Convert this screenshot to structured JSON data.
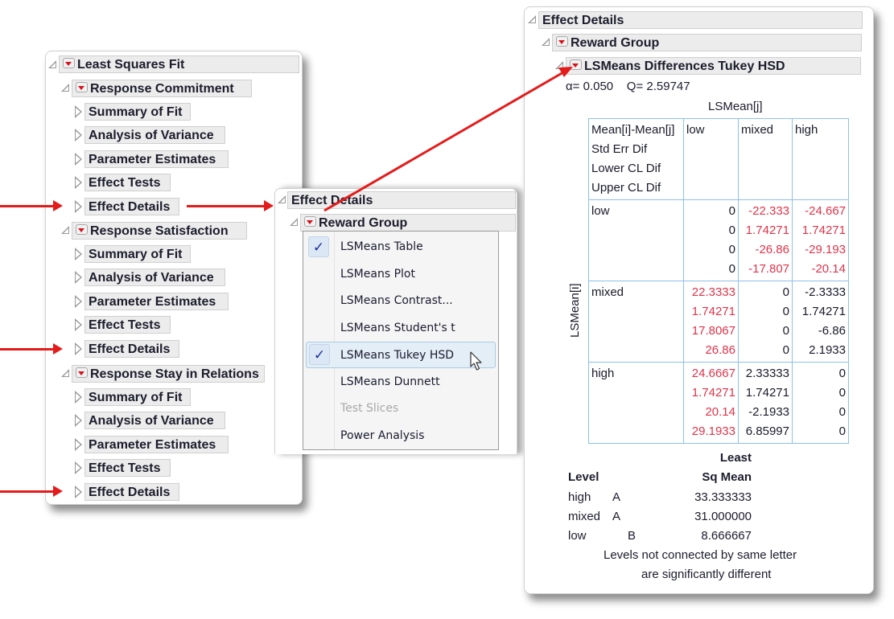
{
  "left_panel": {
    "root": {
      "label": "Least Squares Fit"
    },
    "responses": [
      {
        "label": "Response Commitment",
        "items": [
          "Summary of Fit",
          "Analysis of Variance",
          "Parameter Estimates",
          "Effect Tests",
          "Effect Details"
        ]
      },
      {
        "label": "Response Satisfaction",
        "items": [
          "Summary of Fit",
          "Analysis of Variance",
          "Parameter Estimates",
          "Effect Tests",
          "Effect Details"
        ]
      },
      {
        "label": "Response Stay in Relations",
        "items": [
          "Summary of Fit",
          "Analysis of Variance",
          "Parameter Estimates",
          "Effect Tests",
          "Effect Details"
        ]
      }
    ]
  },
  "middle_panel": {
    "title": "Effect Details",
    "group": "Reward Group",
    "menu": [
      {
        "label": "LSMeans Table",
        "checked": true,
        "enabled": true,
        "hover": false
      },
      {
        "label": "LSMeans Plot",
        "checked": false,
        "enabled": true,
        "hover": false
      },
      {
        "label": "LSMeans Contrast...",
        "checked": false,
        "enabled": true,
        "hover": false
      },
      {
        "label": "LSMeans Student's t",
        "checked": false,
        "enabled": true,
        "hover": false
      },
      {
        "label": "LSMeans Tukey HSD",
        "checked": true,
        "enabled": true,
        "hover": true
      },
      {
        "label": "LSMeans Dunnett",
        "checked": false,
        "enabled": true,
        "hover": false
      },
      {
        "label": "Test Slices",
        "checked": false,
        "enabled": false,
        "hover": false
      },
      {
        "label": "Power Analysis",
        "checked": false,
        "enabled": true,
        "hover": false
      }
    ],
    "check_glyph": "✓"
  },
  "right_panel": {
    "title": "Effect Details",
    "group": "Reward Group",
    "report": "LSMeans Differences Tukey HSD",
    "stats": "α= 0.050    Q= 2.59747",
    "col_header_label": "LSMean[j]",
    "row_header_label": "LSMean[i]",
    "legend_lines": [
      "Mean[i]-Mean[j]",
      "Std Err Dif",
      "Lower CL Dif",
      "Upper CL Dif"
    ],
    "columns": [
      "low",
      "mixed",
      "high"
    ],
    "rows": [
      {
        "level": "low",
        "cells": [
          {
            "values": [
              "0",
              "0",
              "0",
              "0"
            ],
            "significant": false
          },
          {
            "values": [
              "-22.333",
              "1.74271",
              "-26.86",
              "-17.807"
            ],
            "significant": true
          },
          {
            "values": [
              "-24.667",
              "1.74271",
              "-29.193",
              "-20.14"
            ],
            "significant": true
          }
        ]
      },
      {
        "level": "mixed",
        "cells": [
          {
            "values": [
              "22.3333",
              "1.74271",
              "17.8067",
              "26.86"
            ],
            "significant": true
          },
          {
            "values": [
              "0",
              "0",
              "0",
              "0"
            ],
            "significant": false
          },
          {
            "values": [
              "-2.3333",
              "1.74271",
              "-6.86",
              "2.1933"
            ],
            "significant": false
          }
        ]
      },
      {
        "level": "high",
        "cells": [
          {
            "values": [
              "24.6667",
              "1.74271",
              "20.14",
              "29.1933"
            ],
            "significant": true
          },
          {
            "values": [
              "2.33333",
              "1.74271",
              "-2.1933",
              "6.85997"
            ],
            "significant": false
          },
          {
            "values": [
              "0",
              "0",
              "0",
              "0"
            ],
            "significant": false
          }
        ]
      }
    ],
    "connecting_letters": {
      "header_level": "Level",
      "header_mean_line1": "Least",
      "header_mean_line2": "Sq Mean",
      "rows": [
        {
          "level": "high",
          "letter_a": "A",
          "letter_b": "",
          "mean": "33.333333"
        },
        {
          "level": "mixed",
          "letter_a": "A",
          "letter_b": "",
          "mean": "31.000000"
        },
        {
          "level": "low",
          "letter_a": "",
          "letter_b": "B",
          "mean": "8.666667"
        }
      ],
      "footnote_line1": "Levels not connected by same letter",
      "footnote_line2": "are significantly different"
    }
  },
  "colors": {
    "arrow": "#e41b1b",
    "significant": "#e0344a",
    "table_border": "#8fc0e8"
  }
}
